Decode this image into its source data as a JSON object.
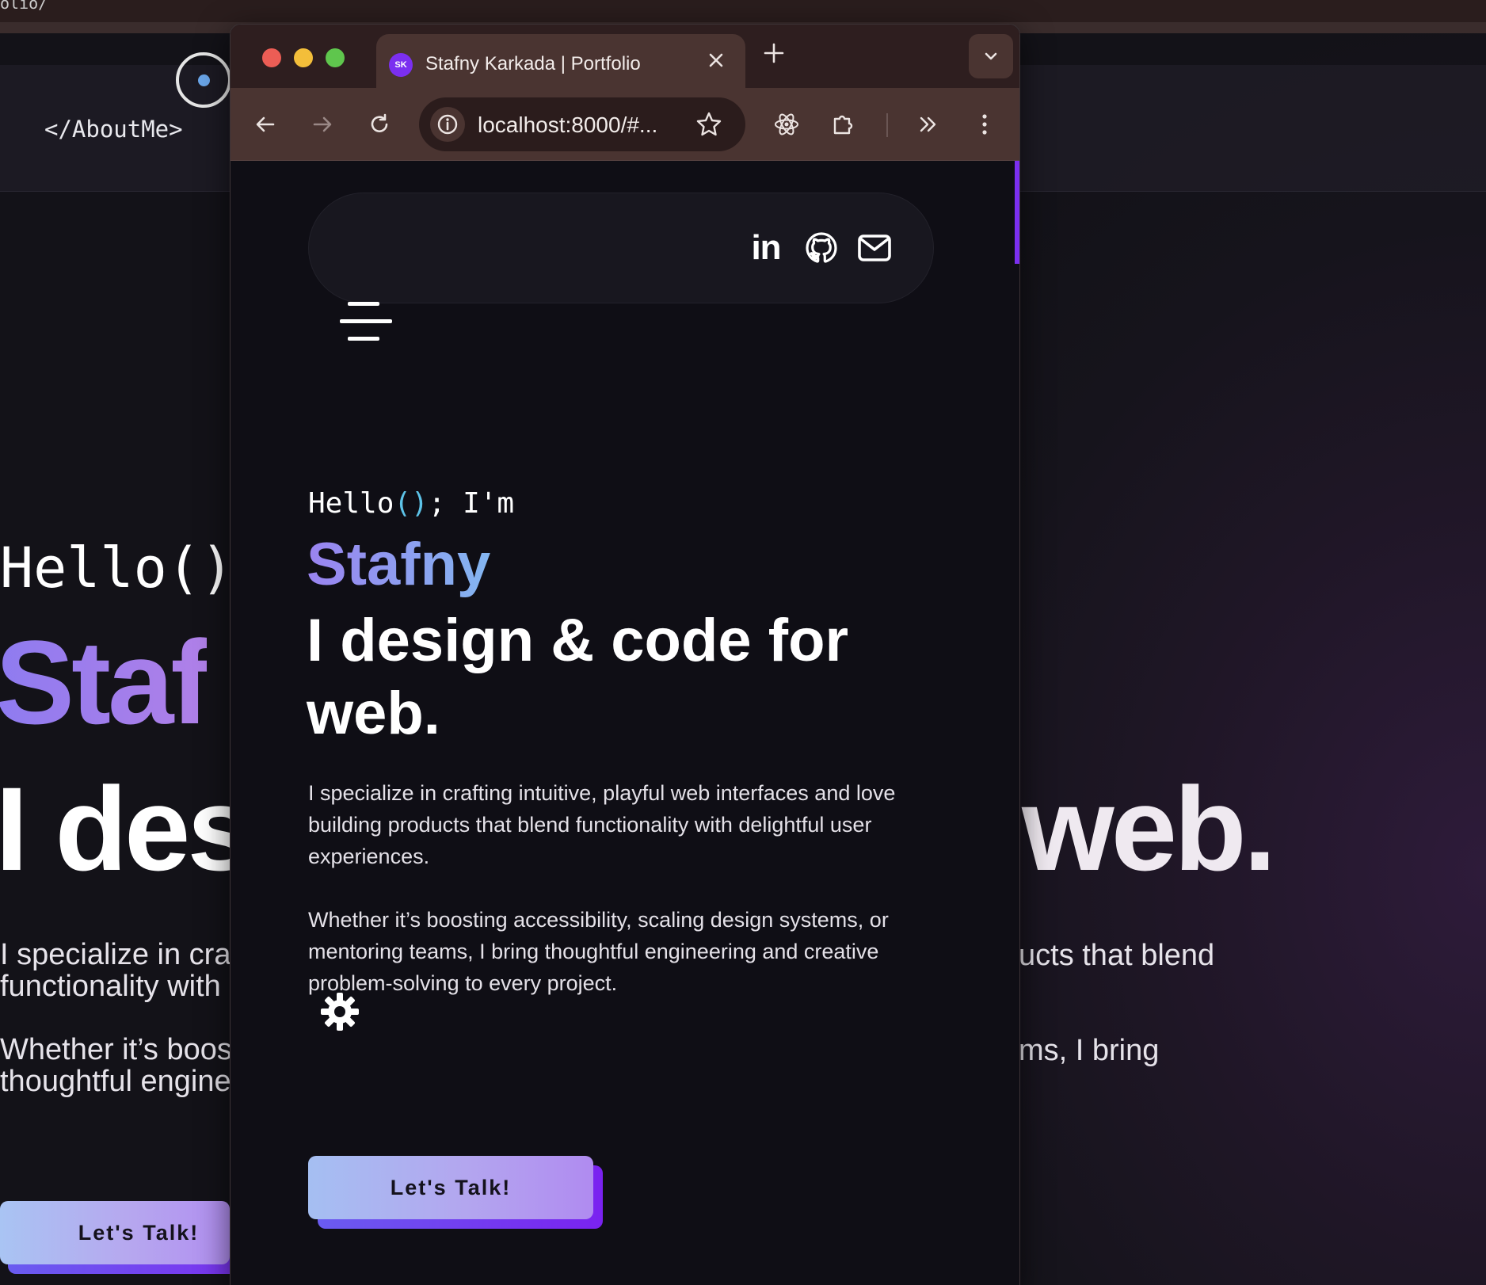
{
  "background": {
    "top_fragment": "olio/",
    "logo": "</AboutMe>",
    "hello": "Hello()",
    "name_fragment": "Staf",
    "design_left": "I des",
    "design_right": "web.",
    "para1_left_line1": "I specialize in cra",
    "para1_left_line2": "functionality with",
    "para1_right": "ucts that blend",
    "para2_left_line1": "Whether it’s boos",
    "para2_left_line2": "thoughtful engine",
    "para2_right": "ms, I bring",
    "cta": "Let's Talk!"
  },
  "browser": {
    "tab_title": "Stafny Karkada | Portfolio",
    "favicon_text": "SK",
    "url": "localhost:8000/#...",
    "accent_color": "#7b2ff0"
  },
  "hero": {
    "hello_prefix": "Hello",
    "hello_parens": "()",
    "hello_suffix": "; I'm",
    "name": "Stafny",
    "headline": "I design & code for web.",
    "para1": "I specialize in crafting intuitive, playful web interfaces and love building products that blend functionality with delightful user experiences.",
    "para2": "Whether it’s boosting accessibility, scaling design systems, or mentoring teams, I bring thoughtful engineering and creative problem-solving to every project.",
    "cta": "Let's Talk!"
  },
  "social": {
    "linkedin": "in"
  },
  "icons": [
    "back-arrow-icon",
    "forward-arrow-icon",
    "reload-icon",
    "info-icon",
    "star-icon",
    "react-icon",
    "extension-icon",
    "chevron-double-right-icon",
    "kebab-menu-icon",
    "linkedin-icon",
    "github-icon",
    "mail-icon",
    "hamburger-icon",
    "gear-icon",
    "close-icon",
    "plus-icon",
    "chevron-down-icon"
  ]
}
